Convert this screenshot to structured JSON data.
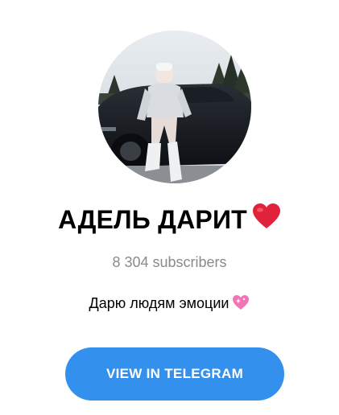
{
  "channel": {
    "title": "АДЕЛЬ ДАРИТ",
    "title_emoji": "red-heart",
    "subscribers": "8 304 subscribers",
    "description": "Дарю людям эмоции",
    "description_emoji": "sparkling-heart"
  },
  "actions": {
    "view_button_label": "VIEW IN TELEGRAM"
  },
  "colors": {
    "button": "#3390ec",
    "subscribers_text": "#8a8a8a"
  }
}
